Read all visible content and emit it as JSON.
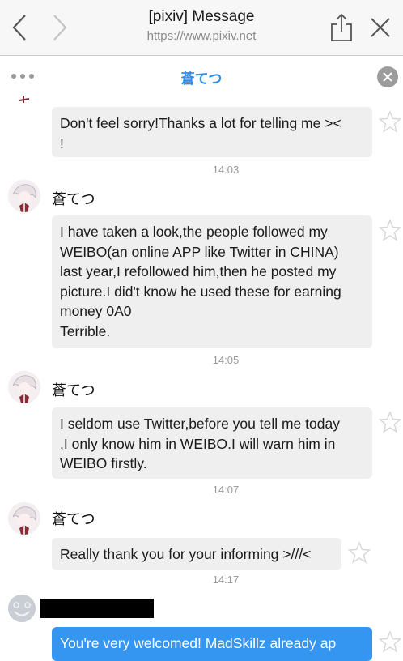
{
  "browser": {
    "title": "[pixiv] Message",
    "url": "https://www.pixiv.net",
    "icons": {
      "back": "chevron-left-icon",
      "forward": "chevron-right-icon",
      "share": "share-icon",
      "close": "close-icon"
    }
  },
  "chat": {
    "partner_name": "蒼てつ",
    "icons": {
      "more": "ellipsis-icon",
      "close": "close-circle-icon"
    },
    "colors": {
      "accent": "#2b8ef0",
      "my_bubble": "#3596f2",
      "their_bubble": "#efefef"
    }
  },
  "messages": [
    {
      "sender": "partner",
      "text": "Don't feel sorry!Thanks a lot for telling me ><\n!",
      "time": "14:03"
    },
    {
      "sender": "partner",
      "name": "蒼てつ",
      "text": "I have taken a look,the people followed my\nWEIBO(an online APP like Twitter in CHINA)\nlast year,I refollowed him,then he posted my\npicture.I did't know he used these for earning\nmoney 0A0\nTerrible.",
      "time": "14:05"
    },
    {
      "sender": "partner",
      "name": "蒼てつ",
      "text": "I seldom use Twitter,before you tell me today\n,I only know him in WEIBO.I will warn him in\nWEIBO firstly.",
      "time": "14:07"
    },
    {
      "sender": "partner",
      "name": "蒼てつ",
      "text": "Really thank you for your informing >///<",
      "time": "14:17"
    },
    {
      "sender": "me",
      "text": "You're very welcomed! MadSkillz already ap"
    }
  ]
}
